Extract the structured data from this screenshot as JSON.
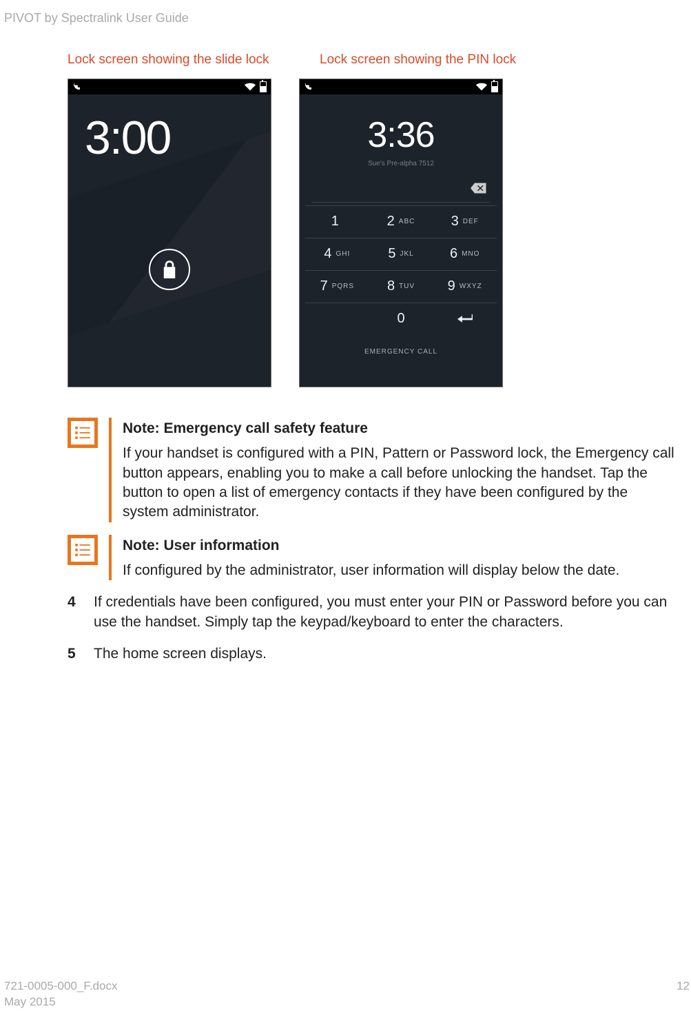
{
  "doc_title": "PIVOT by Spectralink User Guide",
  "caption1": "Lock screen showing the slide lock",
  "caption2": "Lock screen showing the PIN lock",
  "phone1": {
    "time": "3:00"
  },
  "phone2": {
    "time": "3:36",
    "sub": "Sue's Pre-alpha 7512",
    "emergency": "EMERGENCY CALL"
  },
  "keypad": [
    [
      {
        "n": "1",
        "l": ""
      },
      {
        "n": "2",
        "l": "ABC"
      },
      {
        "n": "3",
        "l": "DEF"
      }
    ],
    [
      {
        "n": "4",
        "l": "GHI"
      },
      {
        "n": "5",
        "l": "JKL"
      },
      {
        "n": "6",
        "l": "MNO"
      }
    ],
    [
      {
        "n": "7",
        "l": "PQRS"
      },
      {
        "n": "8",
        "l": "TUV"
      },
      {
        "n": "9",
        "l": "WXYZ"
      }
    ],
    [
      {
        "n": "",
        "l": ""
      },
      {
        "n": "0",
        "l": ""
      },
      {
        "n": "",
        "l": ""
      }
    ]
  ],
  "note1": {
    "title": "Note: Emergency call safety feature",
    "body": "If your handset is configured with a PIN, Pattern or Password lock, the Emergency call button appears, enabling you to make a call before unlocking the handset. Tap the button to open a list of emergency contacts if they have been configured by the system administrator."
  },
  "note2": {
    "title": "Note: User information",
    "body": "If configured by the administrator, user information will display below the date."
  },
  "steps": [
    {
      "num": "4",
      "text": "If credentials have been configured, you must enter your PIN or Password before you can use the handset. Simply tap the keypad/keyboard to enter the characters."
    },
    {
      "num": "5",
      "text": "The home screen displays."
    }
  ],
  "footer": {
    "file": "721-0005-000_F.docx",
    "date": "May 2015",
    "page": "12"
  }
}
